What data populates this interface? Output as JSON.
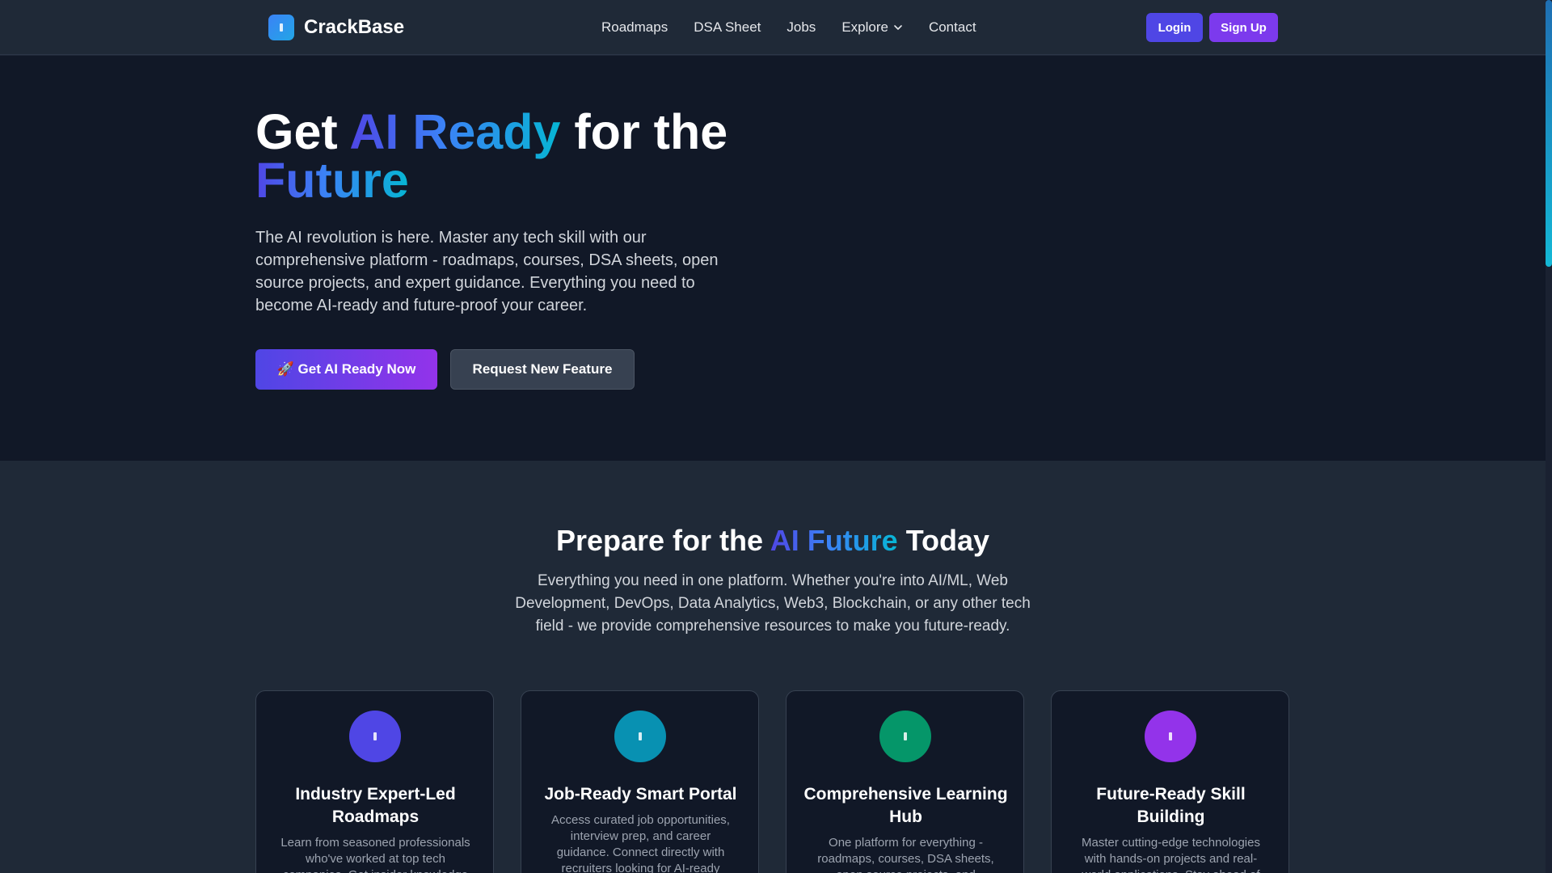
{
  "navbar": {
    "brand": "CrackBase",
    "links": [
      "Roadmaps",
      "DSA Sheet",
      "Jobs",
      "Explore",
      "Contact"
    ],
    "login": "Login",
    "signup": "Sign Up"
  },
  "hero": {
    "title_part1": "Get ",
    "title_highlight1": "AI Ready",
    "title_part2": " for the",
    "title_highlight2": "Future",
    "description": "The AI revolution is here. Master any tech skill with our comprehensive platform - roadmaps, courses, DSA sheets, open source projects, and expert guidance. Everything you need to become AI-ready and future-proof your career.",
    "primary_button": "🚀 Get AI Ready Now",
    "secondary_button": "Request New Feature"
  },
  "features": {
    "title_part1": "Prepare for the ",
    "title_highlight": "AI Future",
    "title_part2": " Today",
    "description": "Everything you need in one platform. Whether you're into AI/ML, Web Development, DevOps, Data Analytics, Web3, Blockchain, or any other tech field - we provide comprehensive resources to make you future-ready.",
    "cards": [
      {
        "title": "Industry Expert-Led Roadmaps",
        "description": "Learn from seasoned professionals who've worked at top tech companies. Get insider knowledge",
        "icon": "roadmap-icon",
        "color": "#4f46e5"
      },
      {
        "title": "Job-Ready Smart Portal",
        "description": "Access curated job opportunities, interview prep, and career guidance. Connect directly with recruiters looking for AI-ready talent.",
        "icon": "briefcase-icon",
        "color": "#0891b2"
      },
      {
        "title": "Comprehensive Learning Hub",
        "description": "One platform for everything - roadmaps, courses, DSA sheets, open source projects, and",
        "icon": "book-icon",
        "color": "#059669"
      },
      {
        "title": "Future-Ready Skill Building",
        "description": "Master cutting-edge technologies with hands-on projects and real-world applications. Stay ahead of",
        "icon": "rocket-icon",
        "color": "#9333ea"
      }
    ]
  }
}
